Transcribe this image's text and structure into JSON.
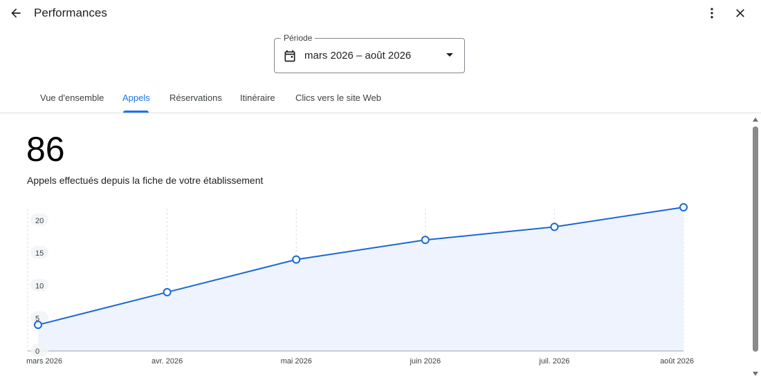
{
  "header": {
    "title": "Performances",
    "back_icon": "arrow-back-icon",
    "more_icon": "more-vert-icon",
    "close_icon": "close-icon"
  },
  "period": {
    "label": "Période",
    "value": "mars 2026 – août 2026",
    "icon": "calendar-icon"
  },
  "tabs": [
    {
      "label": "Vue d'ensemble",
      "active": false
    },
    {
      "label": "Appels",
      "active": true
    },
    {
      "label": "Réservations",
      "active": false
    },
    {
      "label": "Itinéraire",
      "active": false
    },
    {
      "label": "Clics vers le site Web",
      "active": false
    }
  ],
  "summary": {
    "total": "86",
    "description": "Appels effectués depuis la fiche de votre établissement"
  },
  "colors": {
    "accent": "#1a73e8",
    "line": "#1967d2",
    "area_fill": "#eef3fd"
  },
  "chart_data": {
    "type": "line",
    "categories": [
      "mars 2026",
      "avr. 2026",
      "mai 2026",
      "juin 2026",
      "juil. 2026",
      "août 2026"
    ],
    "series": [
      {
        "values": [
          4,
          9,
          14,
          17,
          19,
          22
        ]
      }
    ],
    "yticks": [
      0,
      5,
      10,
      15,
      20
    ],
    "ylim": [
      0,
      22
    ],
    "grid": "vertical-dashed"
  }
}
